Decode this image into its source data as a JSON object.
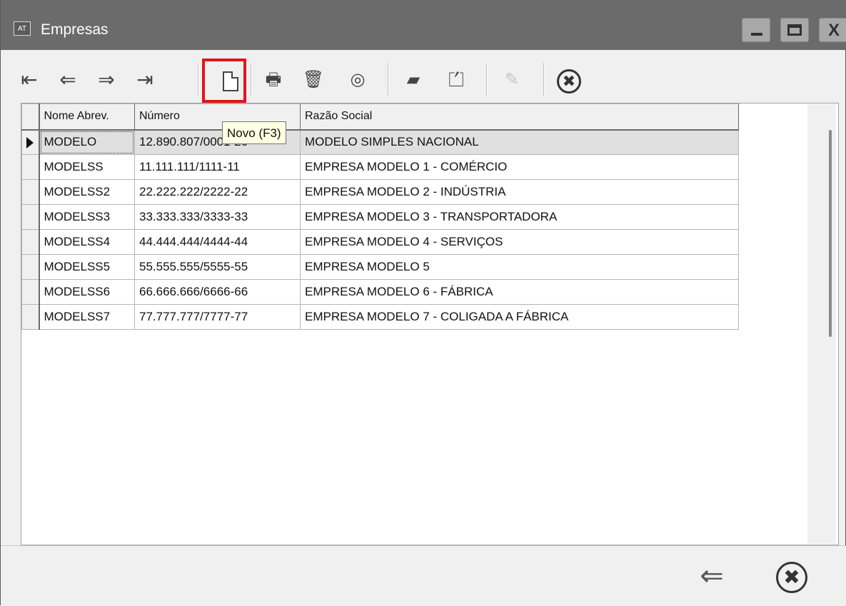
{
  "window": {
    "app_icon_label": "AT",
    "title": "Empresas",
    "close_glyph": "X"
  },
  "toolbar": {
    "first_glyph": "⇤",
    "prev_glyph": "⇐",
    "next_glyph": "⇒",
    "last_glyph": "⇥",
    "print_glyph": "🖶",
    "delete_glyph": "🗑",
    "view_glyph": "◎",
    "clear_glyph": "▰",
    "copy_glyph": "⏍",
    "edit_glyph": "✎",
    "cancel_glyph": "✖"
  },
  "tooltip": "Novo (F3)",
  "grid": {
    "columns": [
      "Nome Abrev.",
      "Número",
      "Razão Social"
    ],
    "rows": [
      {
        "abrev": "MODELO",
        "numero": "12.890.807/0001-20",
        "razao": "MODELO SIMPLES NACIONAL",
        "selected": true
      },
      {
        "abrev": "MODELSS",
        "numero": "11.111.111/1111-11",
        "razao": "EMPRESA MODELO 1 - COMÉRCIO"
      },
      {
        "abrev": "MODELSS2",
        "numero": "22.222.222/2222-22",
        "razao": "EMPRESA MODELO 2 - INDÚSTRIA"
      },
      {
        "abrev": "MODELSS3",
        "numero": "33.333.333/3333-33",
        "razao": "EMPRESA MODELO 3 - TRANSPORTADORA"
      },
      {
        "abrev": "MODELSS4",
        "numero": "44.444.444/4444-44",
        "razao": "EMPRESA MODELO 4 - SERVIÇOS"
      },
      {
        "abrev": "MODELSS5",
        "numero": "55.555.555/5555-55",
        "razao": "EMPRESA MODELO 5"
      },
      {
        "abrev": "MODELSS6",
        "numero": "66.666.666/6666-66",
        "razao": "EMPRESA MODELO 6 - FÁBRICA"
      },
      {
        "abrev": "MODELSS7",
        "numero": "77.777.777/7777-77",
        "razao": "EMPRESA MODELO 7 - COLIGADA A FÁBRICA"
      }
    ]
  },
  "footer": {
    "back_glyph": "⇐",
    "close_glyph": "✖"
  },
  "colors": {
    "titlebar": "#6b6b6b",
    "highlight": "#e3141b",
    "tooltip_bg": "#ffffe1"
  }
}
